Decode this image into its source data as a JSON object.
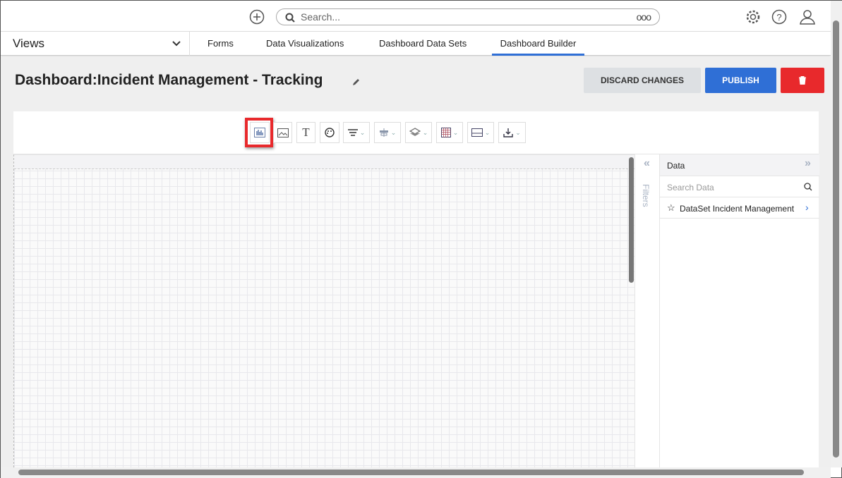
{
  "topbar": {
    "search_placeholder": "Search...",
    "more": "ooo"
  },
  "nav": {
    "views_label": "Views",
    "tabs": [
      {
        "label": "Forms"
      },
      {
        "label": "Data Visualizations"
      },
      {
        "label": "Dashboard Data Sets"
      },
      {
        "label": "Dashboard Builder",
        "active": true
      }
    ]
  },
  "header": {
    "prefix": "Dashboard",
    "separator": ":",
    "title": "Incident Management - Tracking",
    "discard_label": "DISCARD CHANGES",
    "publish_label": "PUBLISH"
  },
  "colors": {
    "accent": "#2f6fd6",
    "danger": "#e8292c",
    "highlight": "#e8292c"
  },
  "toolbar": {
    "tools": [
      "chart-icon",
      "image-icon",
      "text-icon",
      "palette-icon",
      "filter-icon",
      "align-icon",
      "layers-icon",
      "grid-icon",
      "layout-icon",
      "download-icon"
    ],
    "text_tool": "T"
  },
  "filters": {
    "label": "Filters"
  },
  "data_panel": {
    "title": "Data",
    "search_placeholder": "Search Data",
    "items": [
      {
        "label": "DataSet Incident Management"
      }
    ]
  }
}
